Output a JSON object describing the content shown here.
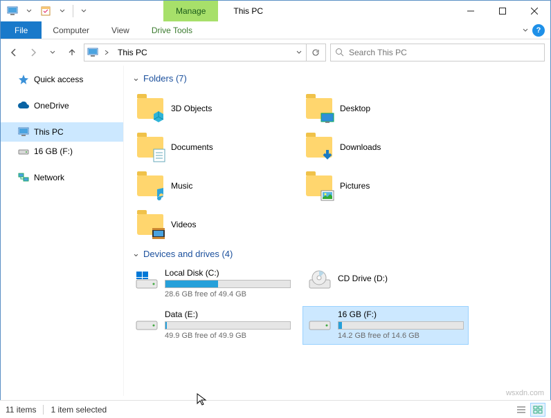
{
  "title": "This PC",
  "ribbon": {
    "manage": "Manage",
    "file": "File",
    "computer": "Computer",
    "view": "View",
    "driveTools": "Drive Tools"
  },
  "address": "This PC",
  "search": {
    "placeholder": "Search This PC"
  },
  "sidebar": {
    "quickAccess": "Quick access",
    "oneDrive": "OneDrive",
    "thisPC": "This PC",
    "drive": "16 GB (F:)",
    "network": "Network"
  },
  "groups": {
    "folders": "Folders (7)",
    "drives": "Devices and drives (4)"
  },
  "folders": {
    "objects3d": "3D Objects",
    "desktop": "Desktop",
    "documents": "Documents",
    "downloads": "Downloads",
    "music": "Music",
    "pictures": "Pictures",
    "videos": "Videos"
  },
  "drives": {
    "c": {
      "name": "Local Disk (C:)",
      "free": "28.6 GB free of 49.4 GB",
      "fill": "42%"
    },
    "d": {
      "name": "CD Drive (D:)"
    },
    "e": {
      "name": "Data (E:)",
      "free": "49.9 GB free of 49.9 GB",
      "fill": "1%"
    },
    "f": {
      "name": "16 GB (F:)",
      "free": "14.2 GB free of 14.6 GB",
      "fill": "3%"
    }
  },
  "status": {
    "items": "11 items",
    "selected": "1 item selected"
  },
  "watermark": "wsxdn.com"
}
